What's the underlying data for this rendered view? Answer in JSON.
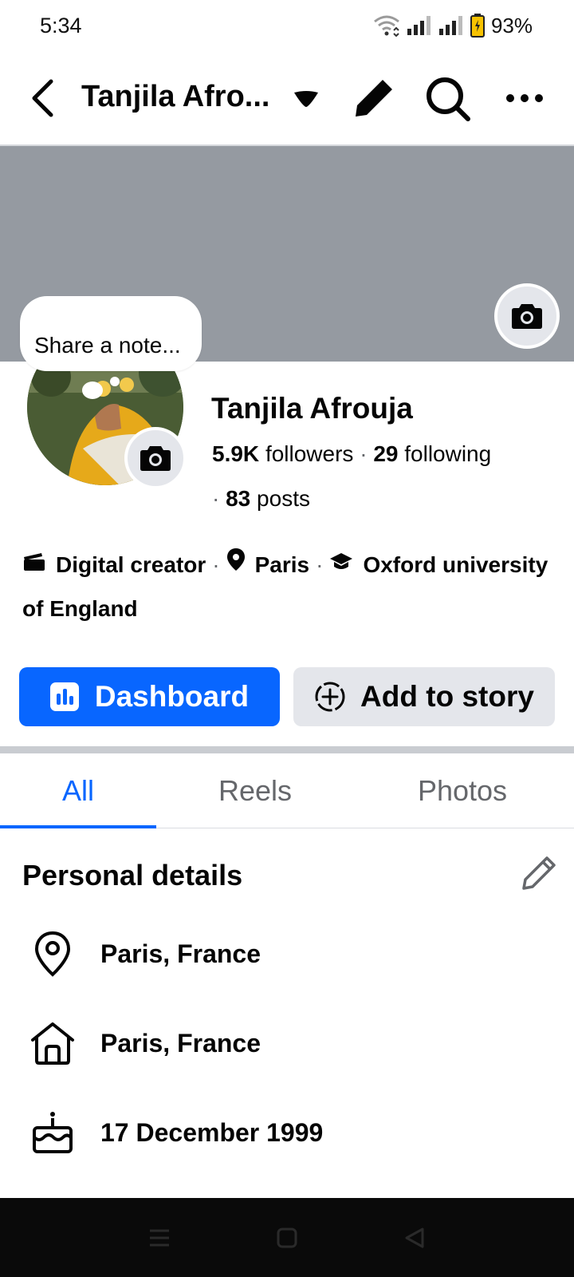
{
  "status_bar": {
    "time": "5:34",
    "battery": "93%"
  },
  "header": {
    "title": "Tanjila Afro...",
    "back_icon": "arrow-left-icon",
    "dropdown_icon": "caret-down-icon",
    "edit_icon": "pencil-icon",
    "search_icon": "search-icon",
    "more_icon": "ellipsis-icon"
  },
  "note": {
    "placeholder": "Share a note..."
  },
  "profile": {
    "name": "Tanjila Afrouja",
    "followers_count": "5.9K",
    "followers_label": "followers",
    "following_count": "29",
    "following_label": "following",
    "posts_count": "83",
    "posts_label": "posts"
  },
  "intro": {
    "category": "Digital creator",
    "location": "Paris",
    "education": "Oxford university of England"
  },
  "actions": {
    "dashboard_label": "Dashboard",
    "add_story_label": "Add to story"
  },
  "tabs": [
    {
      "label": "All",
      "active": true
    },
    {
      "label": "Reels",
      "active": false
    },
    {
      "label": "Photos",
      "active": false
    }
  ],
  "personal_details": {
    "title": "Personal details",
    "rows": [
      {
        "icon": "location-pin-icon",
        "text": "Paris, France"
      },
      {
        "icon": "home-icon",
        "text": "Paris, France"
      },
      {
        "icon": "birthday-cake-icon",
        "text": "17 December 1999"
      }
    ]
  },
  "colors": {
    "accent": "#0866ff",
    "cover": "#959aa1",
    "secondary_button": "#e4e6eb"
  }
}
